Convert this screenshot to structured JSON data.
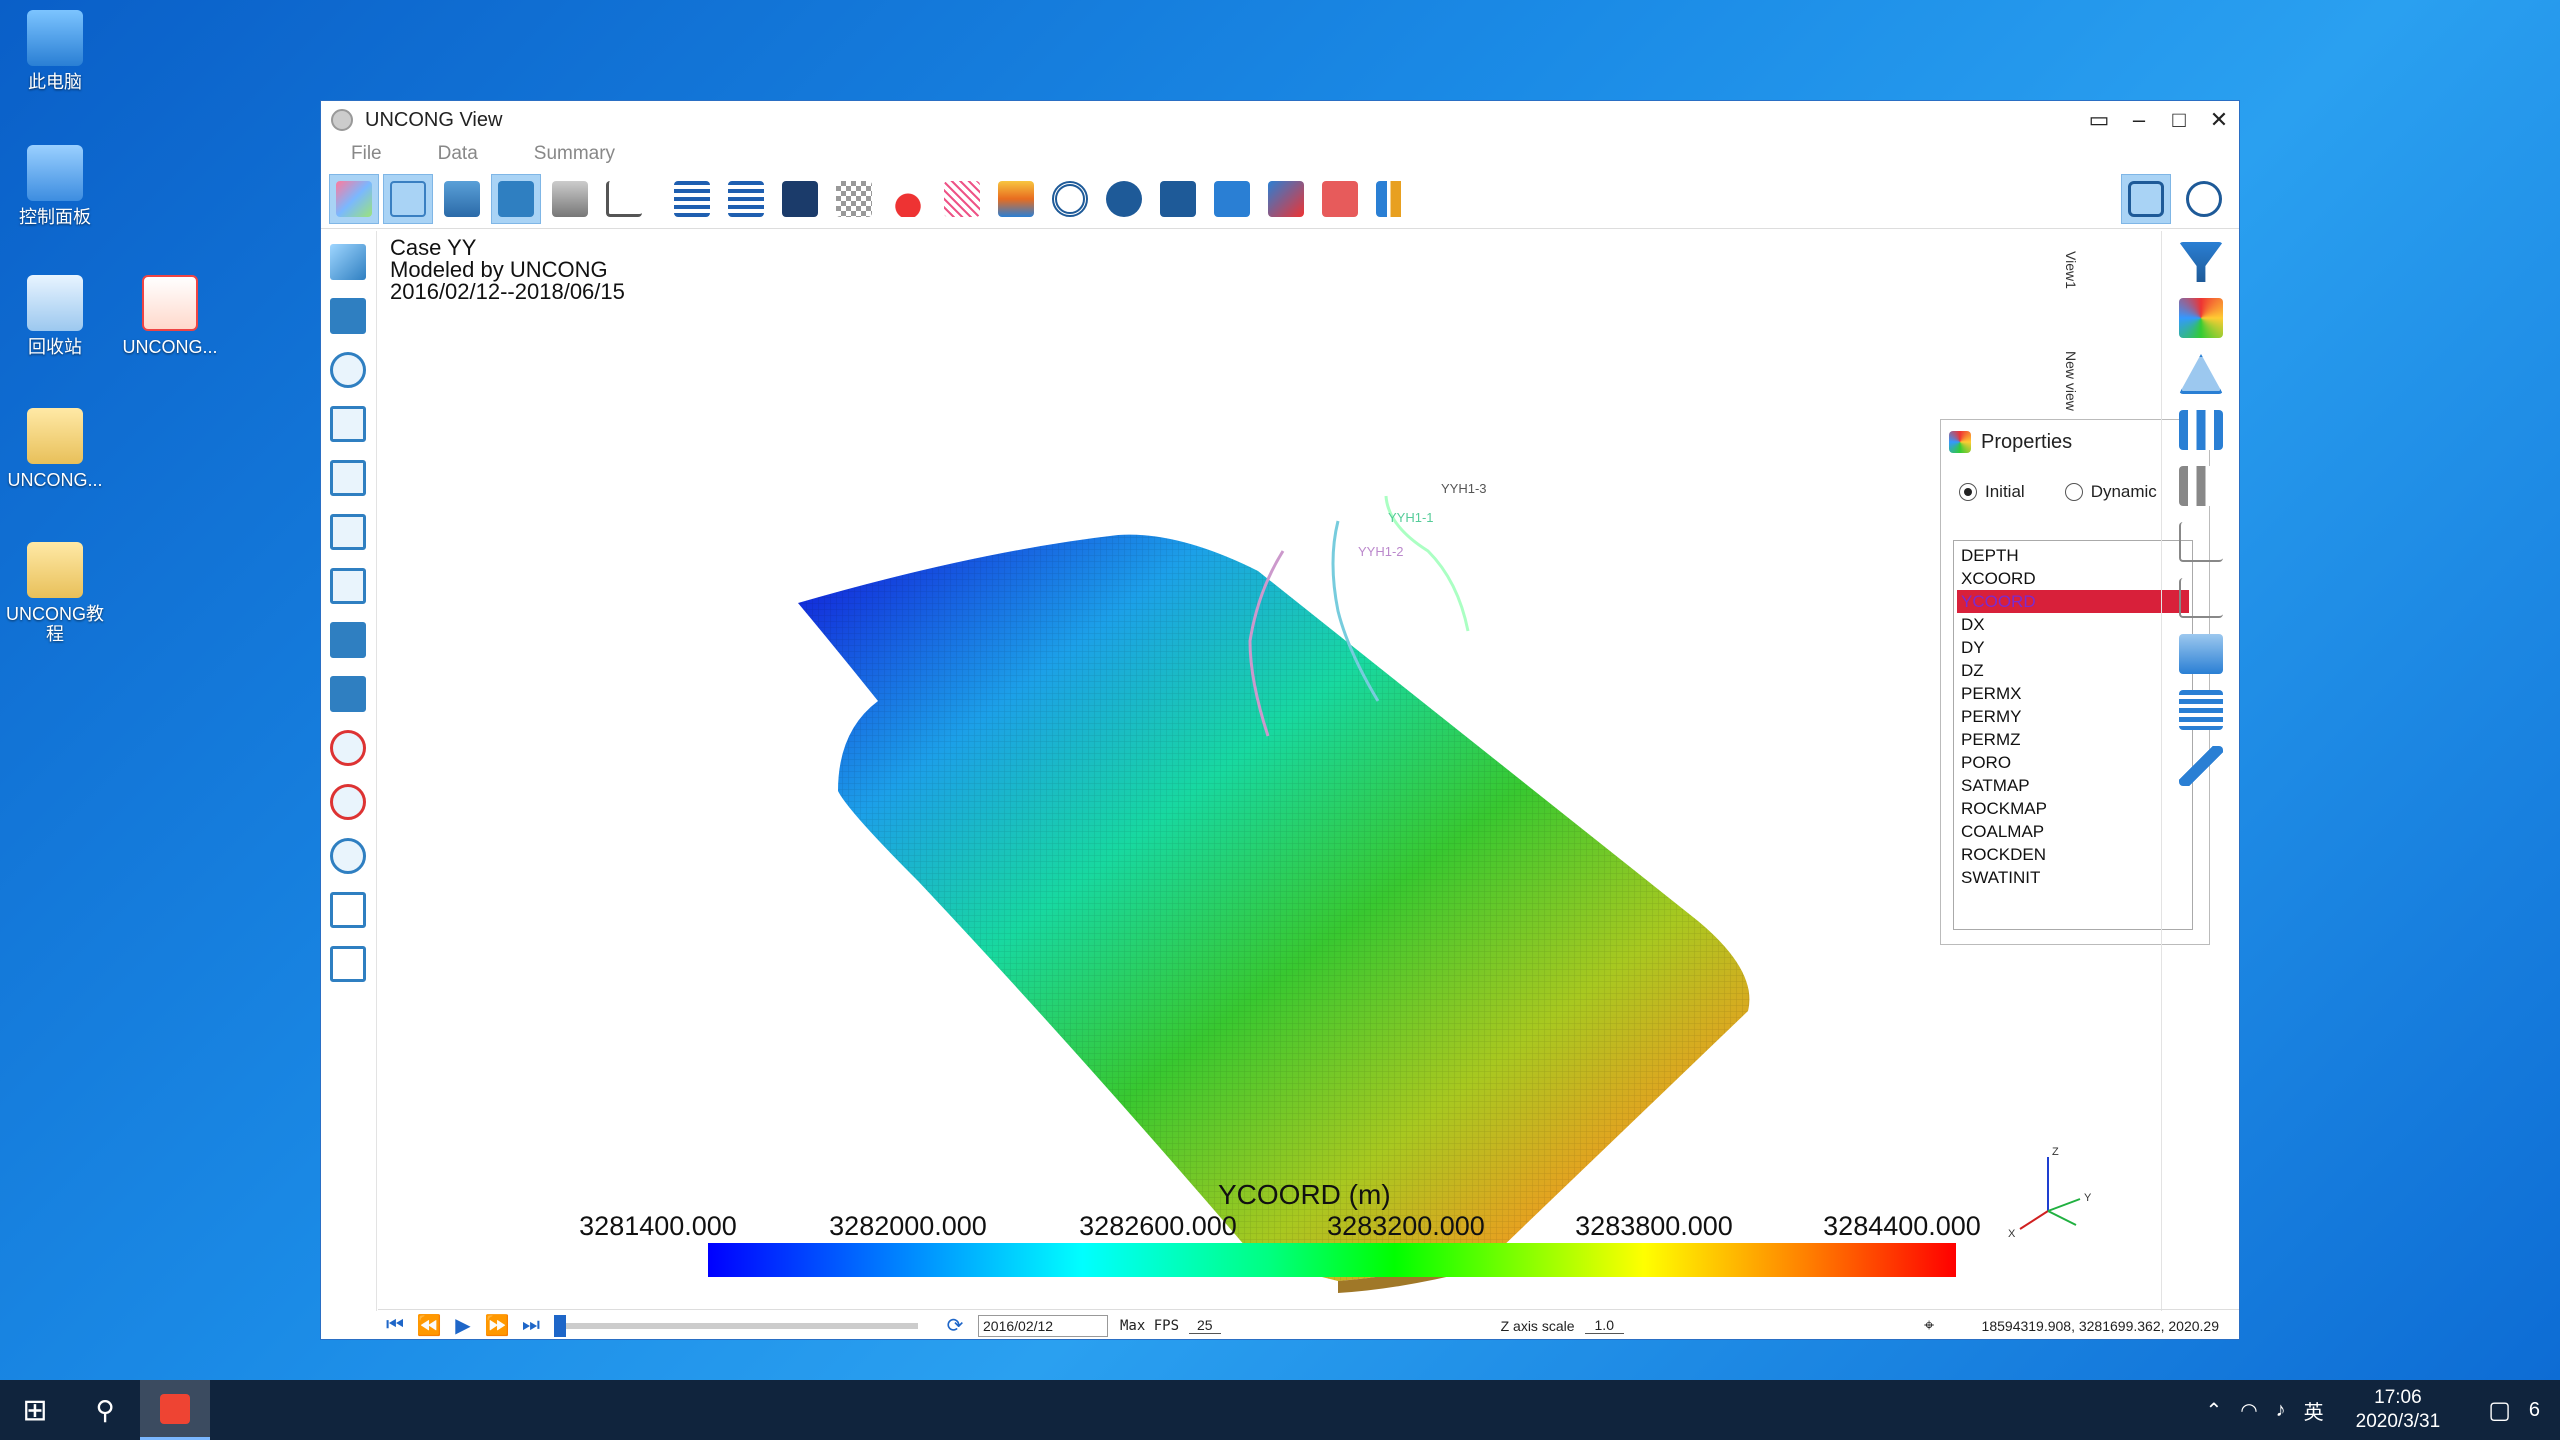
{
  "desktop": {
    "icons": [
      {
        "label": "此电脑"
      },
      {
        "label": "控制面板"
      },
      {
        "label": "回收站"
      },
      {
        "label": "UNCONG..."
      },
      {
        "label": "UNCONG..."
      },
      {
        "label": "UNCONG教程"
      }
    ]
  },
  "window": {
    "title": "UNCONG View",
    "menu": [
      "File",
      "Data",
      "Summary"
    ],
    "case_info": {
      "line1": "Case YY",
      "line2": "Modeled by UNCONG",
      "line3": "2016/02/12--2018/06/15"
    },
    "wells": [
      "YYH1-3",
      "YYH1-1",
      "YYH1-2"
    ],
    "colorbar": {
      "title": "YCOORD (m)",
      "ticks": [
        "3281400.000",
        "3282000.000",
        "3282600.000",
        "3283200.000",
        "3283800.000",
        "3284400.000"
      ]
    },
    "axes": {
      "x": "X",
      "y": "Y",
      "z": "Z"
    },
    "side_tabs": [
      "View1",
      "New view"
    ],
    "properties": {
      "title": "Properties",
      "radio_initial": "Initial",
      "radio_dynamic": "Dynamic",
      "selected": "YCOORD",
      "items": [
        "DEPTH",
        "XCOORD",
        "YCOORD",
        "DX",
        "DY",
        "DZ",
        "PERMX",
        "PERMY",
        "PERMZ",
        "PORO",
        "SATMAP",
        "ROCKMAP",
        "COALMAP",
        "ROCKDEN",
        "SWATINIT"
      ]
    },
    "bottom": {
      "date": "2016/02/12",
      "fps_label": "Max FPS",
      "fps_value": "25",
      "zscale_label": "Z axis scale",
      "zscale_value": "1.0",
      "coords": "18594319.908, 3281699.362, 2020.29"
    }
  },
  "taskbar": {
    "ime": "英",
    "time": "17:06",
    "date": "2020/3/31",
    "notif_count": "6"
  }
}
